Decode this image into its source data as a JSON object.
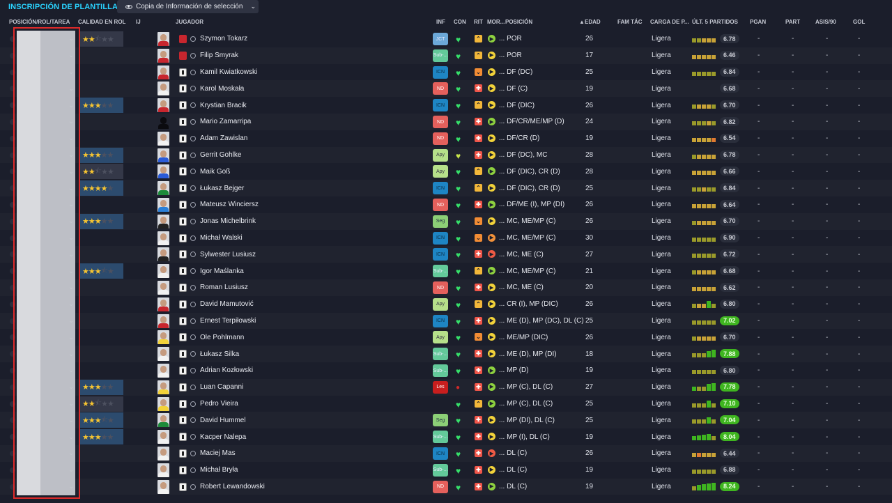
{
  "header": {
    "title": "INSCRIPCIÓN DE PLANTILLA",
    "copy_button": "Copia de Información de selección"
  },
  "columns": {
    "pos_rol": "POSICIÓN/ROL/TAREA",
    "calidad": "CALIDAD EN ROL",
    "ij": "IJ",
    "jugador": "JUGADOR",
    "inf": "INF",
    "con": "CON",
    "rit": "RIT",
    "mor": "MOR...",
    "posicion": "POSICIÓN",
    "edad": "EDAD",
    "fam_tac": "FAM TÁC",
    "carga": "CARGA DE P...",
    "ult5": "ÚLT. 5 PARTIDOS",
    "pgan": "PGAN",
    "part": "PART",
    "asis": "ASIS/90",
    "gol": "GOL"
  },
  "colors": {
    "accent": "#2ad3ff",
    "bg": "#1b1e2b",
    "highlight": "#e02a2a",
    "rating_green": "#3fb520"
  },
  "players": [
    {
      "name": "Szymon Tokarz",
      "stars": 2.5,
      "kit": "red",
      "inf": "JCT",
      "inf_type": "jct",
      "con": "green",
      "rit": "up",
      "mor": "g",
      "pos": "... POR",
      "age": "26",
      "load": "Ligera",
      "form": [
        "#9a9a2a",
        "#9a9a2a",
        "#c8a237",
        "#c8a237",
        "#c8a237"
      ],
      "rating": "6.78",
      "rating_hi": false,
      "dark": false,
      "shirt": "#c8262e"
    },
    {
      "name": "Filip Smyrak",
      "stars": 0,
      "kit": "red",
      "inf": "Sub-...",
      "inf_type": "sub",
      "con": "green",
      "rit": "up",
      "mor": "y",
      "pos": "... POR",
      "age": "17",
      "load": "Ligera",
      "form": [
        "#c8a237",
        "#c8a237",
        "#c8a237",
        "#c8a237",
        "#c8a237"
      ],
      "rating": "6.46",
      "rating_hi": false,
      "dark": false,
      "shirt": "#c8262e"
    },
    {
      "name": "Kamil Kwiatkowski",
      "stars": 0,
      "kit": "white",
      "inf": "ICN",
      "inf_type": "icn",
      "con": "green",
      "rit": "mid",
      "mor": "y",
      "pos": "... DF (DC)",
      "age": "25",
      "load": "Ligera",
      "form": [
        "#9a9a2a",
        "#9a9a2a",
        "#9a9a2a",
        "#9a9a2a",
        "#9a9a2a"
      ],
      "rating": "6.84",
      "rating_hi": false,
      "dark": false,
      "shirt": "#c8262e"
    },
    {
      "name": "Karol Moskała",
      "stars": 0,
      "kit": "white",
      "inf": "ND",
      "inf_type": "nd",
      "con": "green",
      "rit": "down",
      "mor": "y",
      "pos": "... DF (C)",
      "age": "19",
      "load": "Ligera",
      "form": [],
      "rating": "6.68",
      "rating_hi": false,
      "dark": false,
      "shirt": "#f2f2f2"
    },
    {
      "name": "Krystian Bracik",
      "stars": 3,
      "kit": "white",
      "inf": "ICN",
      "inf_type": "icn",
      "con": "green",
      "rit": "up",
      "mor": "y",
      "pos": "... DF (DIC)",
      "age": "26",
      "load": "Ligera",
      "form": [
        "#9a9a2a",
        "#c8a237",
        "#c8a237",
        "#c8a237",
        "#9a9a2a"
      ],
      "rating": "6.70",
      "rating_hi": false,
      "dark": false,
      "shirt": "#c8262e"
    },
    {
      "name": "Mario Zamarripa",
      "stars": 0,
      "kit": "white",
      "inf": "ND",
      "inf_type": "nd",
      "con": "green",
      "rit": "down",
      "mor": "g",
      "pos": "... DF/CR/ME/MP (D)",
      "age": "24",
      "load": "Ligera",
      "form": [
        "#9a9a2a",
        "#9a9a2a",
        "#9a9a2a",
        "#c8a237",
        "#9a9a2a"
      ],
      "rating": "6.82",
      "rating_hi": false,
      "dark": true,
      "shirt": "#0b0b0f"
    },
    {
      "name": "Adam Zawislan",
      "stars": 0,
      "kit": "white",
      "inf": "ND",
      "inf_type": "nd",
      "con": "green",
      "rit": "down",
      "mor": "y",
      "pos": "... DF/CR (D)",
      "age": "19",
      "load": "Ligera",
      "form": [
        "#c8a237",
        "#c8a237",
        "#c8a237",
        "#c8a237",
        "#e07a30"
      ],
      "rating": "6.54",
      "rating_hi": false,
      "dark": false,
      "shirt": "#f2f2f2"
    },
    {
      "name": "Gerrit Gohlke",
      "stars": 3,
      "kit": "white",
      "inf": "Apy",
      "inf_type": "apy",
      "con": "yellow",
      "rit": "down",
      "mor": "y",
      "pos": "... DF (DC), MC",
      "age": "28",
      "load": "Ligera",
      "form": [
        "#9a9a2a",
        "#c8a237",
        "#c8a237",
        "#c8a237",
        "#c8a237"
      ],
      "rating": "6.78",
      "rating_hi": false,
      "dark": false,
      "shirt": "#2a5bd8"
    },
    {
      "name": "Maik Goß",
      "stars": 2.5,
      "kit": "white",
      "inf": "Apy",
      "inf_type": "apy",
      "con": "green",
      "rit": "up",
      "mor": "g",
      "pos": "... DF (DIC), CR (D)",
      "age": "28",
      "load": "Ligera",
      "form": [
        "#c8a237",
        "#c8a237",
        "#c8a237",
        "#c8a237",
        "#c8a237"
      ],
      "rating": "6.66",
      "rating_hi": false,
      "dark": false,
      "shirt": "#2a5bd8"
    },
    {
      "name": "Łukasz Bejger",
      "stars": 4,
      "kit": "white",
      "inf": "ICN",
      "inf_type": "icn",
      "con": "green",
      "rit": "up",
      "mor": "y",
      "pos": "... DF (DIC), CR (D)",
      "age": "25",
      "load": "Ligera",
      "form": [
        "#9a9a2a",
        "#9a9a2a",
        "#c8a237",
        "#9a9a2a",
        "#9a9a2a"
      ],
      "rating": "6.84",
      "rating_hi": false,
      "dark": false,
      "shirt": "#1c8a3a"
    },
    {
      "name": "Mateusz Winciersz",
      "stars": 0,
      "kit": "white",
      "inf": "ND",
      "inf_type": "nd",
      "con": "green",
      "rit": "down",
      "mor": "g",
      "pos": "... DF/ME (I), MP (DI)",
      "age": "26",
      "load": "Ligera",
      "form": [
        "#c8a237",
        "#c8a237",
        "#c8a237",
        "#c8a237",
        "#c8a237"
      ],
      "rating": "6.64",
      "rating_hi": false,
      "dark": false,
      "shirt": "#2a7fd8"
    },
    {
      "name": "Jonas Michelbrink",
      "stars": 3,
      "kit": "white",
      "inf": "Seg",
      "inf_type": "seg",
      "con": "green",
      "rit": "mid",
      "mor": "y",
      "pos": "... MC, ME/MP (C)",
      "age": "26",
      "load": "Ligera",
      "form": [
        "#9a9a2a",
        "#c8a237",
        "#c8a237",
        "#c8a237",
        "#c8a237"
      ],
      "rating": "6.70",
      "rating_hi": false,
      "dark": false,
      "shirt": "#222"
    },
    {
      "name": "Michał Walski",
      "stars": 0,
      "kit": "white",
      "inf": "ICN",
      "inf_type": "icn",
      "con": "green",
      "rit": "mid",
      "mor": "o",
      "pos": "... MC, ME/MP (C)",
      "age": "30",
      "load": "Ligera",
      "form": [
        "#9a9a2a",
        "#9a9a2a",
        "#9a9a2a",
        "#9a9a2a",
        "#9a9a2a"
      ],
      "rating": "6.90",
      "rating_hi": false,
      "dark": false,
      "shirt": "#f2f2f2"
    },
    {
      "name": "Sylwester Lusiusz",
      "stars": 0,
      "kit": "white",
      "inf": "ICN",
      "inf_type": "icn",
      "con": "green",
      "rit": "down",
      "mor": "r",
      "pos": "... MC, ME (C)",
      "age": "27",
      "load": "Ligera",
      "form": [
        "#9a9a2a",
        "#9a9a2a",
        "#9a9a2a",
        "#9a9a2a",
        "#9a9a2a"
      ],
      "rating": "6.72",
      "rating_hi": false,
      "dark": false,
      "shirt": "#222"
    },
    {
      "name": "Igor Maślanka",
      "stars": 3.5,
      "kit": "white",
      "inf": "Sub-...",
      "inf_type": "sub",
      "con": "green",
      "rit": "up",
      "mor": "g",
      "pos": "... MC, ME/MP (C)",
      "age": "21",
      "load": "Ligera",
      "form": [
        "#9a9a2a",
        "#c8a237",
        "#c8a237",
        "#c8a237",
        "#c8a237"
      ],
      "rating": "6.68",
      "rating_hi": false,
      "dark": false,
      "shirt": "#f2f2f2"
    },
    {
      "name": "Roman Lusiusz",
      "stars": 0,
      "kit": "white",
      "inf": "ND",
      "inf_type": "nd",
      "con": "green",
      "rit": "down",
      "mor": "y",
      "pos": "... MC, ME (C)",
      "age": "20",
      "load": "Ligera",
      "form": [
        "#c8a237",
        "#c8a237",
        "#c8a237",
        "#c8a237",
        "#c8a237"
      ],
      "rating": "6.62",
      "rating_hi": false,
      "dark": false,
      "shirt": "#f2f2f2"
    },
    {
      "name": "David Mamutović",
      "stars": 0,
      "kit": "white",
      "inf": "Apy",
      "inf_type": "apy",
      "con": "green",
      "rit": "up",
      "mor": "y",
      "pos": "... CR (I), MP (DIC)",
      "age": "26",
      "load": "Ligera",
      "form": [
        "#9a9a2a",
        "#c8a237",
        "#c8a237",
        "#3fb520",
        "#9a9a2a"
      ],
      "rating": "6.80",
      "rating_hi": false,
      "dark": false,
      "shirt": "#c8262e"
    },
    {
      "name": "Ernest Terpiłowski",
      "stars": 0,
      "kit": "white",
      "inf": "ICN",
      "inf_type": "icn",
      "con": "green",
      "rit": "down",
      "mor": "y",
      "pos": "... ME (D), MP (DC), DL (C)",
      "age": "25",
      "load": "Ligera",
      "form": [
        "#9a9a2a",
        "#9a9a2a",
        "#9a9a2a",
        "#9a9a2a",
        "#9a9a2a"
      ],
      "rating": "7.02",
      "rating_hi": true,
      "dark": false,
      "shirt": "#c8262e"
    },
    {
      "name": "Ole Pohlmann",
      "stars": 0,
      "kit": "white",
      "inf": "Apy",
      "inf_type": "apy",
      "con": "green",
      "rit": "mid",
      "mor": "y",
      "pos": "... ME/MP (DIC)",
      "age": "26",
      "load": "Ligera",
      "form": [
        "#9a9a2a",
        "#c8a237",
        "#c8a237",
        "#c8a237",
        "#c8a237"
      ],
      "rating": "6.70",
      "rating_hi": false,
      "dark": false,
      "shirt": "#f2d23a"
    },
    {
      "name": "Łukasz Silka",
      "stars": 0,
      "kit": "white",
      "inf": "Sub-...",
      "inf_type": "sub",
      "con": "green",
      "rit": "down",
      "mor": "y",
      "pos": "... ME (D), MP (DI)",
      "age": "18",
      "load": "Ligera",
      "form": [
        "#9a9a2a",
        "#9a9a2a",
        "#9a9a2a",
        "#3fb520",
        "#3fb520"
      ],
      "rating": "7.88",
      "rating_hi": true,
      "dark": false,
      "shirt": "#f2f2f2"
    },
    {
      "name": "Adrian Kozłowski",
      "stars": 0,
      "kit": "white",
      "inf": "Sub-...",
      "inf_type": "sub",
      "con": "green",
      "rit": "down",
      "mor": "g",
      "pos": "... MP (D)",
      "age": "19",
      "load": "Ligera",
      "form": [
        "#9a9a2a",
        "#9a9a2a",
        "#9a9a2a",
        "#9a9a2a",
        "#9a9a2a"
      ],
      "rating": "6.80",
      "rating_hi": false,
      "dark": false,
      "shirt": "#f2f2f2"
    },
    {
      "name": "Luan Capanni",
      "stars": 3,
      "kit": "white",
      "inf": "Les",
      "inf_type": "les",
      "con": "red",
      "rit": "down",
      "mor": "g",
      "pos": "... MP (C), DL (C)",
      "age": "27",
      "load": "Ligera",
      "form": [
        "#3fb520",
        "#9a9a2a",
        "#9a9a2a",
        "#3fb520",
        "#3fb520"
      ],
      "rating": "7.78",
      "rating_hi": true,
      "dark": false,
      "shirt": "#f2d23a"
    },
    {
      "name": "Pedro Vieira",
      "stars": 2.5,
      "kit": "white",
      "inf": "",
      "inf_type": "none",
      "con": "green",
      "rit": "up",
      "mor": "g",
      "pos": "... MP (C), DL (C)",
      "age": "25",
      "load": "Ligera",
      "form": [
        "#9a9a2a",
        "#9a9a2a",
        "#9a9a2a",
        "#3fb520",
        "#9a9a2a"
      ],
      "rating": "7.10",
      "rating_hi": true,
      "dark": false,
      "shirt": "#f2d23a"
    },
    {
      "name": "David Hummel",
      "stars": 3.5,
      "kit": "white",
      "inf": "Seg",
      "inf_type": "seg",
      "con": "green",
      "rit": "down",
      "mor": "y",
      "pos": "... MP (DI), DL (C)",
      "age": "25",
      "load": "Ligera",
      "form": [
        "#9a9a2a",
        "#9a9a2a",
        "#9a9a2a",
        "#3fb520",
        "#9a9a2a"
      ],
      "rating": "7.04",
      "rating_hi": true,
      "dark": false,
      "shirt": "#1c8a3a"
    },
    {
      "name": "Kacper Nalepa",
      "stars": 3,
      "kit": "white",
      "inf": "Sub-...",
      "inf_type": "sub",
      "con": "green",
      "rit": "down",
      "mor": "y",
      "pos": "... MP (I), DL (C)",
      "age": "19",
      "load": "Ligera",
      "form": [
        "#3fb520",
        "#3fb520",
        "#3fb520",
        "#3fb520",
        "#9a9a2a"
      ],
      "rating": "8.04",
      "rating_hi": true,
      "dark": false,
      "shirt": "#f2f2f2"
    },
    {
      "name": "Maciej Mas",
      "stars": 0,
      "kit": "white",
      "inf": "ICN",
      "inf_type": "icn",
      "con": "green",
      "rit": "down",
      "mor": "r",
      "pos": "... DL (C)",
      "age": "26",
      "load": "Ligera",
      "form": [
        "#c8a237",
        "#e07a30",
        "#c8a237",
        "#c8a237",
        "#c8a237"
      ],
      "rating": "6.44",
      "rating_hi": false,
      "dark": false,
      "shirt": "#f2f2f2"
    },
    {
      "name": "Michał Bryła",
      "stars": 0,
      "kit": "white",
      "inf": "Sub-...",
      "inf_type": "sub",
      "con": "green",
      "rit": "down",
      "mor": "y",
      "pos": "... DL (C)",
      "age": "19",
      "load": "Ligera",
      "form": [
        "#9a9a2a",
        "#9a9a2a",
        "#9a9a2a",
        "#9a9a2a",
        "#9a9a2a"
      ],
      "rating": "6.88",
      "rating_hi": false,
      "dark": false,
      "shirt": "#f2f2f2"
    },
    {
      "name": "Robert Lewandowski",
      "stars": 0,
      "kit": "white",
      "inf": "ND",
      "inf_type": "nd",
      "con": "green",
      "rit": "down",
      "mor": "g",
      "pos": "... DL (C)",
      "age": "19",
      "load": "Ligera",
      "form": [
        "#9a9a2a",
        "#3fb520",
        "#3fb520",
        "#3fb520",
        "#3fb520"
      ],
      "rating": "8.24",
      "rating_hi": true,
      "dark": false,
      "shirt": "#f2f2f2"
    }
  ],
  "dash": "-"
}
